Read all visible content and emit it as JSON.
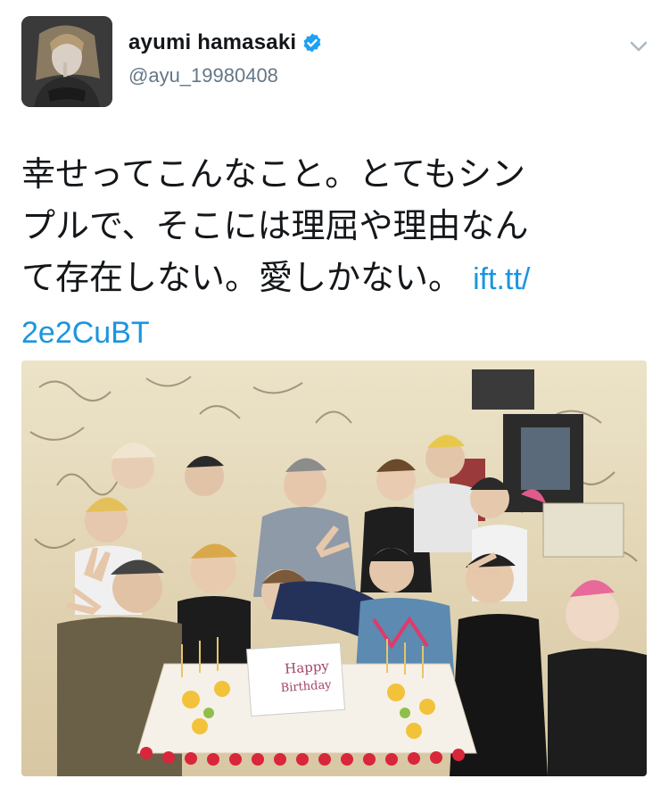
{
  "user": {
    "display_name": "ayumi hamasaki",
    "handle": "@ayu_19980408",
    "verified": true,
    "avatar_icon": "profile-photo"
  },
  "tweet": {
    "text": "幸せってこんなこと。とてもシンプルで、そこには理屈や理由なんて存在しない。愛しかない。",
    "link_part1": "ift.tt/",
    "link_part2": "2e2CuBT"
  },
  "media": {
    "type": "photo",
    "cake_plaque_line1": "Happy",
    "cake_plaque_line2": "Birthday"
  },
  "colors": {
    "link": "#1b95e0",
    "verified": "#1da1f2",
    "handle": "#657786"
  }
}
